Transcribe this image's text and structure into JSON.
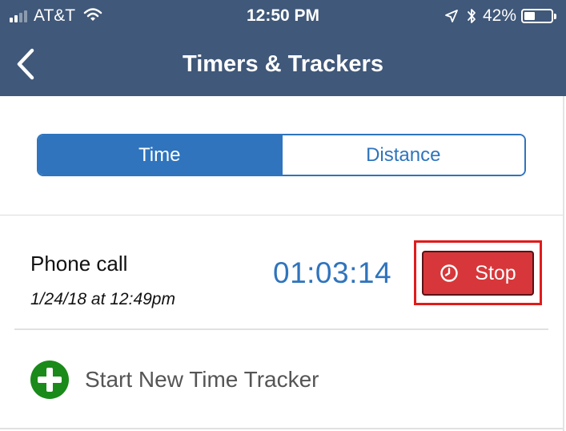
{
  "status_bar": {
    "carrier": "AT&T",
    "time": "12:50 PM",
    "battery_percent": "42%",
    "battery_level": 0.42,
    "signal_bars_filled": 2,
    "signal_bars_total": 4,
    "icons": [
      "signal-icon",
      "wifi-icon",
      "location-arrow-icon",
      "bluetooth-icon",
      "battery-icon"
    ]
  },
  "nav": {
    "title": "Timers & Trackers",
    "back_icon": "chevron-left-icon"
  },
  "segments": [
    {
      "label": "Time",
      "selected": true
    },
    {
      "label": "Distance",
      "selected": false
    }
  ],
  "tracker": {
    "name": "Phone call",
    "date": "1/24/18 at 12:49pm",
    "elapsed": "01:03:14",
    "stop_label": "Stop",
    "stop_icon": "clock-icon"
  },
  "add_tracker": {
    "label": "Start New Time Tracker",
    "icon": "plus-circle-icon"
  },
  "colors": {
    "header_bg": "#405879",
    "accent_blue": "#2f74bd",
    "stop_red": "#d7373a",
    "highlight_red": "#e01b1b",
    "add_green": "#1a8a1a"
  }
}
